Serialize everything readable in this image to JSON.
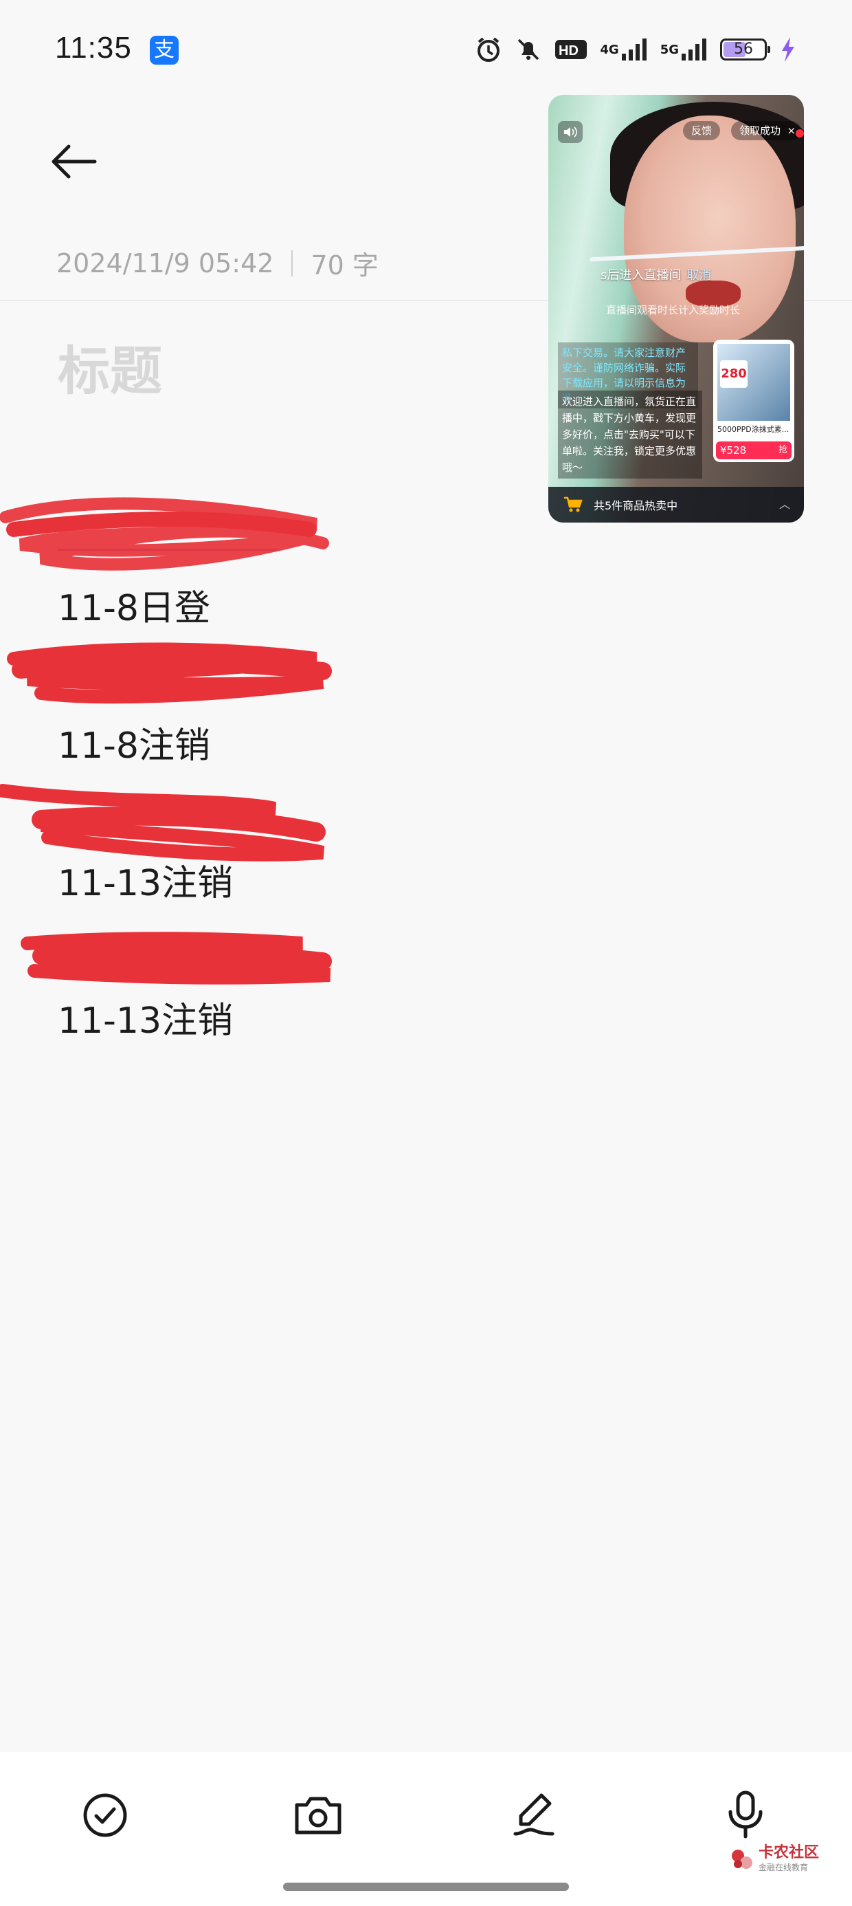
{
  "status_bar": {
    "time": "11:35",
    "app_badge": "支",
    "net_4g": "4G",
    "net_5g": "5G",
    "battery": "56"
  },
  "note": {
    "date": "2024/11/9 05:42",
    "word_count": "70 字",
    "title_placeholder": "标题",
    "lines": [
      {
        "text": "11-8日登"
      },
      {
        "text": "11-8注销"
      },
      {
        "text": "11-13注销"
      },
      {
        "text": "11-13注销"
      }
    ]
  },
  "toolbar": {
    "items": [
      "checklist-icon",
      "camera-icon",
      "pen-icon",
      "microphone-icon"
    ]
  },
  "pip": {
    "feedback": "反馈",
    "claim": "领取成功",
    "cta": "s后进入直播间",
    "cancel": "取消",
    "cta_sub": "直播间观看时长计入奖励时长",
    "warning": "私下交易。请大家注意财产安全。谨防网络诈骗。实际下载应用，请以明示信息为准。",
    "welcome": "欢迎进入直播间，氛货正在直播中，戳下方小黄车，发现更多好价，点击\"去购买\"可以下单啦。关注我，锁定更多优惠哦～",
    "product_badge": "280",
    "product_name": "5000PPD涂抹式素...",
    "product_price": "¥528",
    "product_buy": "抢",
    "cart_text": "共5件商品热卖中"
  },
  "watermark": {
    "name": "卡农社区",
    "sub": "金融在线教育"
  },
  "colors": {
    "background": "#f8f8f8",
    "scribble": "#e8323a",
    "link": "#4b7fd1",
    "price": "#ff2d55"
  }
}
